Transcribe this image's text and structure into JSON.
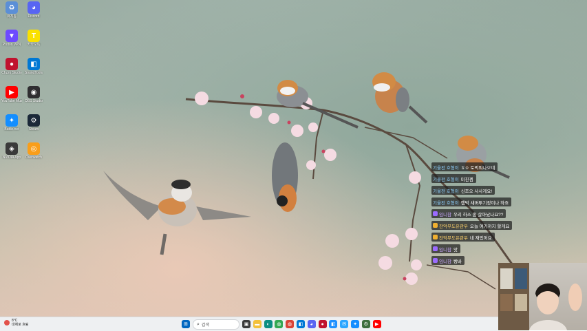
{
  "desktop_icons": [
    {
      "label": "휴지통",
      "icon": "recycle-bin-icon",
      "color": "#5b8fd6"
    },
    {
      "label": "Discord",
      "icon": "discord-icon",
      "color": "#5865f2"
    },
    {
      "label": "Proton VPN",
      "icon": "vpn-icon",
      "color": "#6d4aff"
    },
    {
      "label": "카카오톡",
      "icon": "kakaotalk-icon",
      "color": "#fae100"
    },
    {
      "label": "Chzzk Studio",
      "icon": "studio-icon",
      "color": "#c0122e"
    },
    {
      "label": "SoundTools",
      "icon": "app-icon",
      "color": "#0078d4"
    },
    {
      "label": "YouTube Music",
      "icon": "youtube-music-icon",
      "color": "#ff0000"
    },
    {
      "label": "OBS Studio",
      "icon": "obs-icon",
      "color": "#302e31"
    },
    {
      "label": "Battle.net",
      "icon": "battlenet-icon",
      "color": "#148eff"
    },
    {
      "label": "Steam",
      "icon": "steam-icon",
      "color": "#1b2838"
    },
    {
      "label": "NVIDIA App",
      "icon": "nvidia-icon",
      "color": "#3a3a3a"
    },
    {
      "label": "Overwatch",
      "icon": "overwatch-icon",
      "color": "#f99e1a"
    }
  ],
  "chat": [
    {
      "nick": "기울전 호형이",
      "text": "ㅎㅇ 토먹뭐나오네",
      "badge": "",
      "nick_color": "#8fd1ff"
    },
    {
      "nick": "기울전 호형이",
      "text": "미친겜",
      "badge": "",
      "nick_color": "#8fd1ff"
    },
    {
      "nick": "기울전 호형이",
      "text": "신조오 사사게요!",
      "badge": "",
      "nick_color": "#8fd1ff"
    },
    {
      "nick": "기울전 호형이",
      "text": "햄벅 새버투기정이나 하죠",
      "badge": "",
      "nick_color": "#8fd1ff"
    },
    {
      "nick": "임니참",
      "text": "우리 하스 좀 살아났나요??",
      "badge": "#9b6bff",
      "nick_color": "#c9a8ff"
    },
    {
      "nick": "잔악무도유관우",
      "text": "오늘 여기까지 할게요",
      "badge": "#f0b030",
      "nick_color": "#ffd36b"
    },
    {
      "nick": "잔악무도유관우",
      "text": "네 재밌어요",
      "badge": "#f0b030",
      "nick_color": "#ffd36b"
    },
    {
      "nick": "임니참",
      "text": "앗",
      "badge": "#9b6bff",
      "nick_color": "#c9a8ff"
    },
    {
      "nick": "임니참",
      "text": "빵바",
      "badge": "#9b6bff",
      "nick_color": "#c9a8ff"
    }
  ],
  "taskbar": {
    "weather_temp": "8°C",
    "weather_desc": "대체로 흐림",
    "search_placeholder": "검색",
    "apps": [
      {
        "icon": "start-icon",
        "color": "#0067c0"
      },
      {
        "icon": "task-view-icon",
        "color": "#3a3a3a"
      },
      {
        "icon": "file-explorer-icon",
        "color": "#f3c13a"
      },
      {
        "icon": "edge-icon",
        "color": "#0c8e82"
      },
      {
        "icon": "chrome-icon",
        "color": "#34a853"
      },
      {
        "icon": "chrome-icon",
        "color": "#db4437"
      },
      {
        "icon": "app-icon",
        "color": "#0078d4"
      },
      {
        "icon": "discord-icon",
        "color": "#5865f2"
      },
      {
        "icon": "studio-icon",
        "color": "#c0122e"
      },
      {
        "icon": "app-icon",
        "color": "#1e90ff"
      },
      {
        "icon": "chat-icon",
        "color": "#2aa6ff"
      },
      {
        "icon": "battlenet-icon",
        "color": "#148eff"
      },
      {
        "icon": "steam-icon",
        "color": "#3d6e3d"
      },
      {
        "icon": "youtube-music-icon",
        "color": "#ff0000"
      }
    ]
  }
}
